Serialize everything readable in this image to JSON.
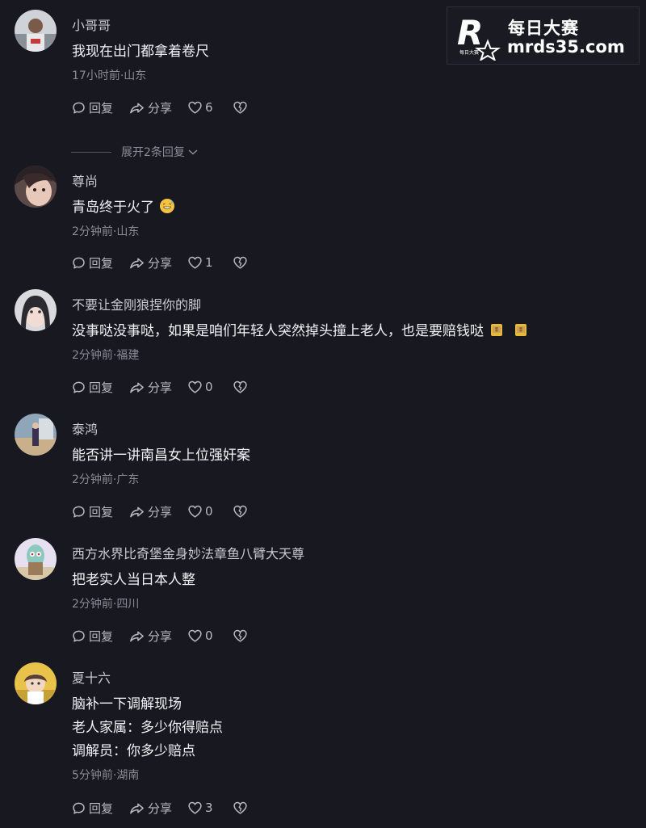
{
  "watermark": {
    "brand_cn": "每日大赛",
    "url": "mrds35.com",
    "logo_letter": "R",
    "logo_small_text": "每日大赛"
  },
  "labels": {
    "reply": "回复",
    "share": "分享"
  },
  "comments": [
    {
      "username": "小哥哥",
      "lines": [
        "我现在出门都拿着卷尺"
      ],
      "meta": "17小时前·山东",
      "likes": "6",
      "expand": "展开2条回复"
    },
    {
      "username": "尊尚",
      "lines": [
        "青岛终于火了"
      ],
      "meta": "2分钟前·山东",
      "likes": "1"
    },
    {
      "username": "不要让金刚狼捏你的脚",
      "lines": [
        "没事哒没事哒，如果是咱们年轻人突然掉头撞上老人，也是要赔钱哒"
      ],
      "meta": "2分钟前·福建",
      "likes": "0"
    },
    {
      "username": "泰鸿",
      "lines": [
        "能否讲一讲南昌女上位强奸案"
      ],
      "meta": "2分钟前·广东",
      "likes": "0"
    },
    {
      "username": "西方水界比奇堡金身妙法章鱼八臂大天尊",
      "lines": [
        "把老实人当日本人整"
      ],
      "meta": "2分钟前·四川",
      "likes": "0"
    },
    {
      "username": "夏十六",
      "lines": [
        "脑补一下调解现场",
        "老人家属：多少你得赔点",
        "调解员：你多少赔点"
      ],
      "meta": "5分钟前·湖南",
      "likes": "3"
    }
  ]
}
